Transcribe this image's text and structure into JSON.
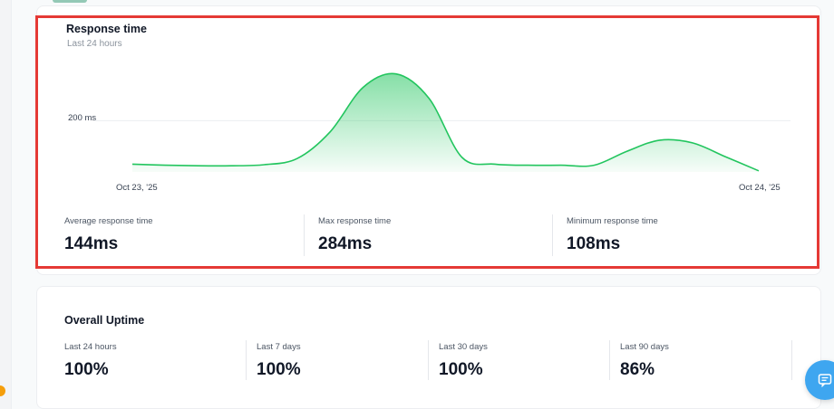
{
  "response_card": {
    "title": "Response time",
    "subtitle": "Last 24 hours",
    "stats": [
      {
        "label": "Average response time",
        "value": "144ms"
      },
      {
        "label": "Max response time",
        "value": "284ms"
      },
      {
        "label": "Minimum response time",
        "value": "108ms"
      }
    ]
  },
  "uptime_card": {
    "title": "Overall Uptime",
    "stats": [
      {
        "label": "Last 24 hours",
        "value": "100%"
      },
      {
        "label": "Last 7 days",
        "value": "100%"
      },
      {
        "label": "Last 30 days",
        "value": "100%"
      },
      {
        "label": "Last 90 days",
        "value": "86%"
      }
    ]
  },
  "chart_data": {
    "type": "area",
    "title": "Response time",
    "subtitle": "Last 24 hours",
    "x": [
      "Oct 23, '25",
      "Oct 24, '25"
    ],
    "xtick_labels": [
      "Oct 23, '25",
      "Oct 24, '25"
    ],
    "ytick_labels": [
      "200 ms"
    ],
    "ytick_values": [
      200
    ],
    "series": [
      {
        "values": [
          122,
          120,
          119,
          119,
          121,
          132,
          180,
          260,
          284,
          240,
          134,
          122,
          120,
          120,
          120,
          145,
          165,
          160,
          135,
          110
        ]
      }
    ],
    "ylim": [
      108,
      290
    ],
    "color": "#22c55e",
    "grid": true
  }
}
